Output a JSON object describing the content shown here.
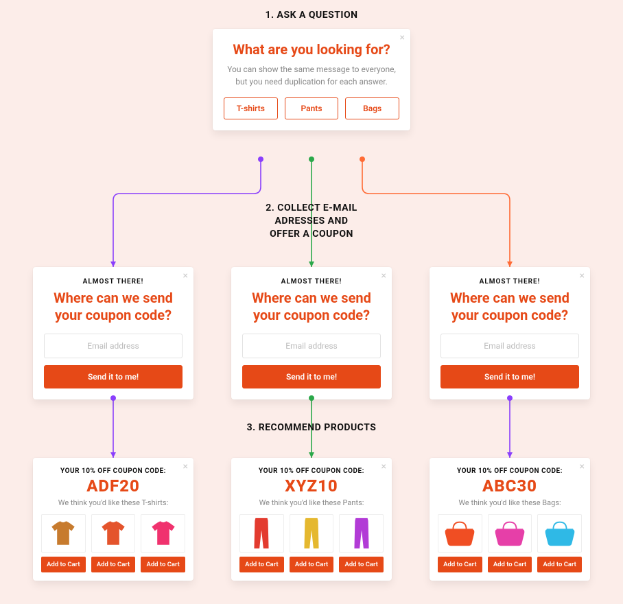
{
  "steps": {
    "s1": "1. ASK A QUESTION",
    "s2a": "2. COLLECT E-MAIL",
    "s2b": "ADRESSES AND",
    "s2c": "OFFER A COUPON",
    "s3": "3. RECOMMEND PRODUCTS"
  },
  "question": {
    "title": "What are you looking for?",
    "subtitle": "You can show the same message to everyone, but you need duplication for each answer.",
    "options": [
      "T-shirts",
      "Pants",
      "Bags"
    ]
  },
  "email": {
    "eyebrow": "ALMOST THERE!",
    "title": "Where can we send your coupon code?",
    "placeholder": "Email address",
    "button": "Send it to me!"
  },
  "products": {
    "eyebrow": "YOUR 10% OFF COUPON CODE:",
    "add": "Add to Cart",
    "cards": [
      {
        "code": "ADF20",
        "sub": "We think you'd like these T-shirts:",
        "type": "tshirt",
        "colors": [
          "#C77B2E",
          "#E4542C",
          "#F0326E"
        ]
      },
      {
        "code": "XYZ10",
        "sub": "We think you'd like these Pants:",
        "type": "pants",
        "colors": [
          "#E33B2F",
          "#E5B82F",
          "#B23BD6"
        ]
      },
      {
        "code": "ABC30",
        "sub": "We think you'd like these Bags:",
        "type": "bag",
        "colors": [
          "#F04E23",
          "#E63FA8",
          "#2FB9E6"
        ]
      }
    ]
  },
  "colors": {
    "purple": "#8A3FFC",
    "green": "#2BA84A",
    "orange": "#FF6B35"
  }
}
